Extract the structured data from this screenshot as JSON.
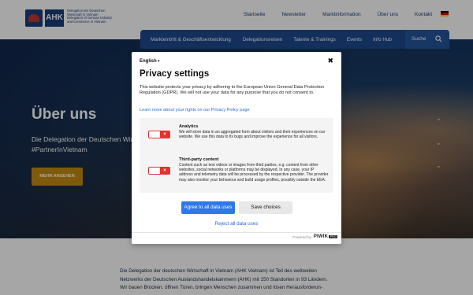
{
  "header": {
    "logo_brand": "AHK",
    "logo_text": "Delegation der Deutschen Wirtschaft in Vietnam Delegation of German Industry and Commerce in Vietnam",
    "top_nav": [
      "Startseite",
      "Newsletter",
      "Marktinformation",
      "Über uns",
      "Kontakt"
    ],
    "flag_colors": [
      "#000000",
      "#dd0000",
      "#ffce00"
    ]
  },
  "main_nav": {
    "items": [
      "Markteintritt & Geschäftsentwicklung",
      "Delegationsreisen",
      "Talente & Trainings",
      "Events",
      "Info Hub"
    ],
    "search_label": "Suche"
  },
  "hero": {
    "title": "Über uns",
    "subtitle_line1": "Die Delegation der Deutschen Wir",
    "subtitle_line2": "#PartnerInVietnam",
    "button_label": "MEHR ANSEHEN",
    "chevron_icons": [
      "chevron-down-icon",
      "chevron-down-icon",
      "chevron-down-icon"
    ]
  },
  "body_text": {
    "line1": "Die Delegation der deutschen Wirtschaft in Vietnam (AHK Vietnam) ist Teil des weltweiten",
    "line2": "Netzwerks der Deutschen Auslandshandelskammern (AHK) mit 150 Standorten in 93 Ländern.",
    "line3": "Wir bauen Brücken, öffnen Türen, bringen Menschen zusammen und lösen Herausforderun-"
  },
  "modal": {
    "language": "English",
    "title": "Privacy settings",
    "description": "This website protects your privacy by adhering to the European Union General Data Protection Regulation (GDPR). We will not use your data for any purpose that you do not consent to.",
    "policy_link": "Learn more about your rights on our Privacy Policy page",
    "options": [
      {
        "title": "Analytics",
        "description": "We will store data in an aggregated form about visitors and their experiences on our website. We use this data to fix bugs and improve the experience for all visitors.",
        "enabled": false
      },
      {
        "title": "Third-party content",
        "description": "Content such as text videos or images from third parties, e.g. content from other websites, social networks or platforms may be displayed. In any case, your IP address and telemetry data will be processed by the respective provider. The provider may also monitor your behaviour and build usage profiles, possibly outside the EEA.",
        "enabled": false
      }
    ],
    "agree_button": "Agree to all data uses",
    "save_button": "Save choices",
    "reject_link": "Reject all data uses",
    "powered_by": "Powered by",
    "piwik": "PIWIK",
    "piwik_badge": "PRO"
  }
}
